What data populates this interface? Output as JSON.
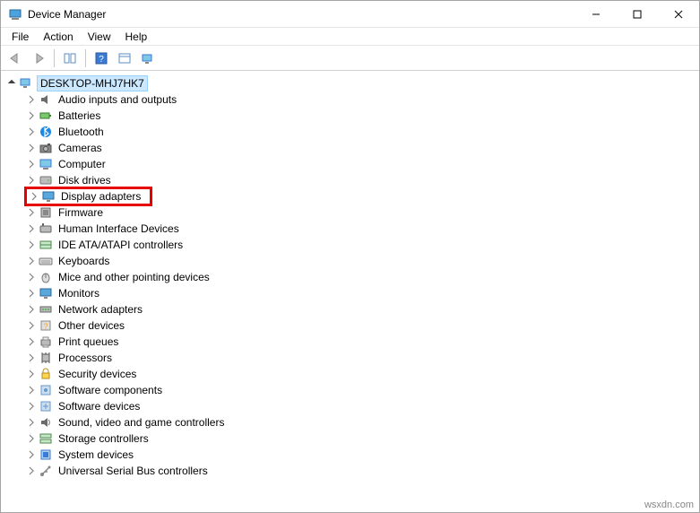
{
  "window": {
    "title": "Device Manager"
  },
  "menu": {
    "file": "File",
    "action": "Action",
    "view": "View",
    "help": "Help"
  },
  "tree": {
    "root": "DESKTOP-MHJ7HK7",
    "items": [
      {
        "label": "Audio inputs and outputs",
        "icon": "speaker"
      },
      {
        "label": "Batteries",
        "icon": "battery"
      },
      {
        "label": "Bluetooth",
        "icon": "bluetooth"
      },
      {
        "label": "Cameras",
        "icon": "camera"
      },
      {
        "label": "Computer",
        "icon": "computer"
      },
      {
        "label": "Disk drives",
        "icon": "disk"
      },
      {
        "label": "Display adapters",
        "icon": "display",
        "highlighted": true
      },
      {
        "label": "Firmware",
        "icon": "firmware"
      },
      {
        "label": "Human Interface Devices",
        "icon": "hid"
      },
      {
        "label": "IDE ATA/ATAPI controllers",
        "icon": "ide"
      },
      {
        "label": "Keyboards",
        "icon": "keyboard"
      },
      {
        "label": "Mice and other pointing devices",
        "icon": "mouse"
      },
      {
        "label": "Monitors",
        "icon": "monitor"
      },
      {
        "label": "Network adapters",
        "icon": "network"
      },
      {
        "label": "Other devices",
        "icon": "other"
      },
      {
        "label": "Print queues",
        "icon": "printer"
      },
      {
        "label": "Processors",
        "icon": "cpu"
      },
      {
        "label": "Security devices",
        "icon": "security"
      },
      {
        "label": "Software components",
        "icon": "swcomp"
      },
      {
        "label": "Software devices",
        "icon": "swdev"
      },
      {
        "label": "Sound, video and game controllers",
        "icon": "sound"
      },
      {
        "label": "Storage controllers",
        "icon": "storage"
      },
      {
        "label": "System devices",
        "icon": "system"
      },
      {
        "label": "Universal Serial Bus controllers",
        "icon": "usb"
      }
    ]
  },
  "watermark": "wsxdn.com"
}
